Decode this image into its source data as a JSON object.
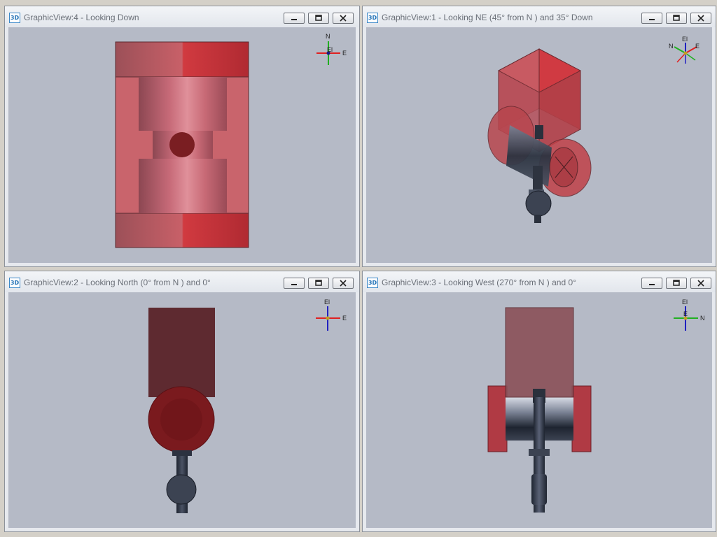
{
  "app_icon_text": "3D",
  "views": [
    {
      "title": "GraphicView:4 - Looking Down",
      "axis_labels": [
        "N",
        "El",
        "E"
      ]
    },
    {
      "title": "GraphicView:1 - Looking NE (45° from N ) and 35° Down",
      "axis_labels": [
        "El",
        "N",
        "E"
      ]
    },
    {
      "title": "GraphicView:2 - Looking North (0° from N ) and 0°",
      "axis_labels": [
        "El",
        "E"
      ]
    },
    {
      "title": "GraphicView:3 - Looking West (270° from N ) and 0°",
      "axis_labels": [
        "El",
        "N",
        "E"
      ]
    }
  ],
  "window_controls": [
    "minimize-icon",
    "restore-icon",
    "close-icon"
  ],
  "colors": {
    "viewport_bg": "#b5bac6",
    "valve_red": "#c24a52",
    "actuator_dark_red": "#5e2a30",
    "pipe_steel": "#3c4352",
    "axis_red": "#e02020",
    "axis_green": "#20b020",
    "axis_blue": "#2020c0"
  }
}
